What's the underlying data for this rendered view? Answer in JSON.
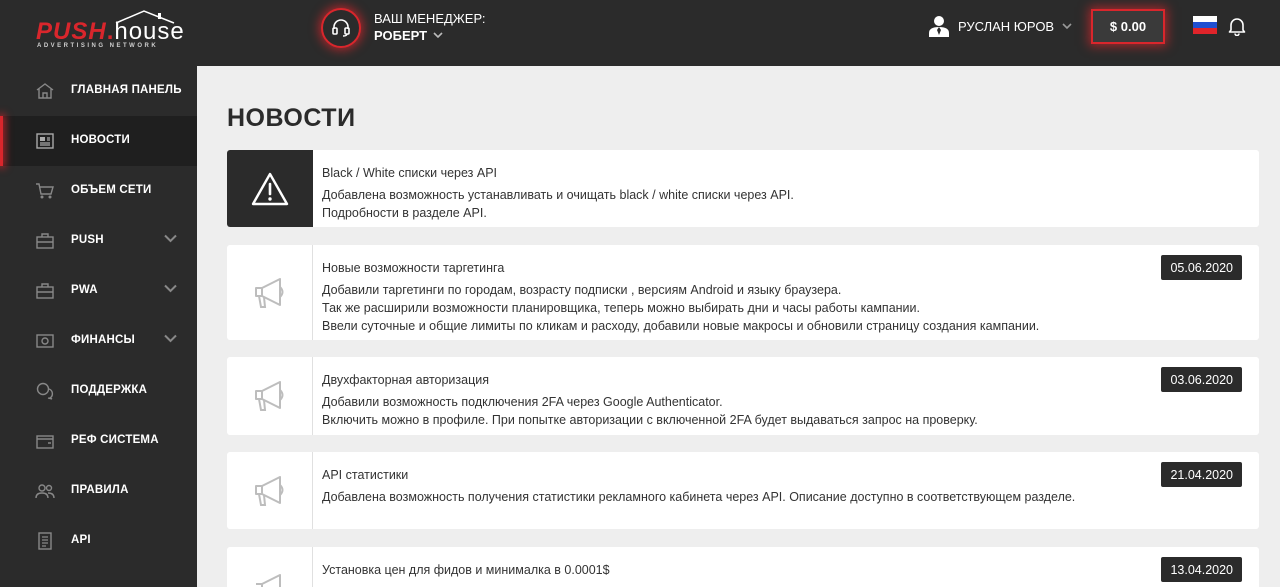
{
  "header": {
    "logo_main": "PUSH",
    "logo_dot": ".",
    "logo_house": "house",
    "logo_sub": "ADVERTISING NETWORK",
    "manager_label": "ВАШ МЕНЕДЖЕР:",
    "manager_name": "РОБЕРТ",
    "user_name": "РУСЛАН ЮРОВ",
    "balance": "$ 0.00",
    "accent_color": "#d9262c"
  },
  "sidebar": {
    "items": [
      {
        "label": "ГЛАВНАЯ ПАНЕЛЬ",
        "icon": "home-icon"
      },
      {
        "label": "НОВОСТИ",
        "icon": "news-icon",
        "active": true
      },
      {
        "label": "ОБЪЕМ СЕТИ",
        "icon": "cart-icon"
      },
      {
        "label": "PUSH",
        "icon": "briefcase-icon",
        "has_submenu": true
      },
      {
        "label": "PWA",
        "icon": "briefcase-icon",
        "has_submenu": true
      },
      {
        "label": "ФИНАНСЫ",
        "icon": "money-icon",
        "has_submenu": true
      },
      {
        "label": "ПОДДЕРЖКА",
        "icon": "chat-icon"
      },
      {
        "label": "РЕФ СИСТЕМА",
        "icon": "wallet-icon"
      },
      {
        "label": "ПРАВИЛА",
        "icon": "users-icon"
      },
      {
        "label": "API",
        "icon": "document-icon"
      }
    ]
  },
  "main": {
    "title": "НОВОСТИ",
    "news": [
      {
        "title": "Black / White списки через API",
        "lines": [
          "Добавлена возможность устанавливать и очищать black / white списки через API.",
          "Подробности в разделе API."
        ],
        "icon": "warning-icon"
      },
      {
        "title": "Новые возможности таргетинга",
        "date": "05.06.2020",
        "lines": [
          "Добавили таргетинги по городам, возрасту подписки , версиям Android и языку браузера.",
          "Так же расширили возможности планировщика, теперь можно выбирать дни и часы работы кампании.",
          "Ввели суточные и общие лимиты по кликам и расходу, добавили новые макросы и обновили страницу создания кампании."
        ],
        "icon": "megaphone-icon"
      },
      {
        "title": "Двухфакторная авторизация",
        "date": "03.06.2020",
        "lines": [
          "Добавили возможность подключения 2FA через Google Authenticator.",
          "Включить можно в профиле. При попытке авторизации с включенной 2FA будет выдаваться запрос на проверку."
        ],
        "icon": "megaphone-icon"
      },
      {
        "title": "API статистики",
        "date": "21.04.2020",
        "lines": [
          "Добавлена возможность получения статистики рекламного кабинета через API. Описание доступно в соответствующем разделе."
        ],
        "icon": "megaphone-icon"
      },
      {
        "title": "Установка цен для фидов и минималка в 0.0001$",
        "date": "13.04.2020",
        "lines": [],
        "icon": "megaphone-icon"
      }
    ]
  }
}
